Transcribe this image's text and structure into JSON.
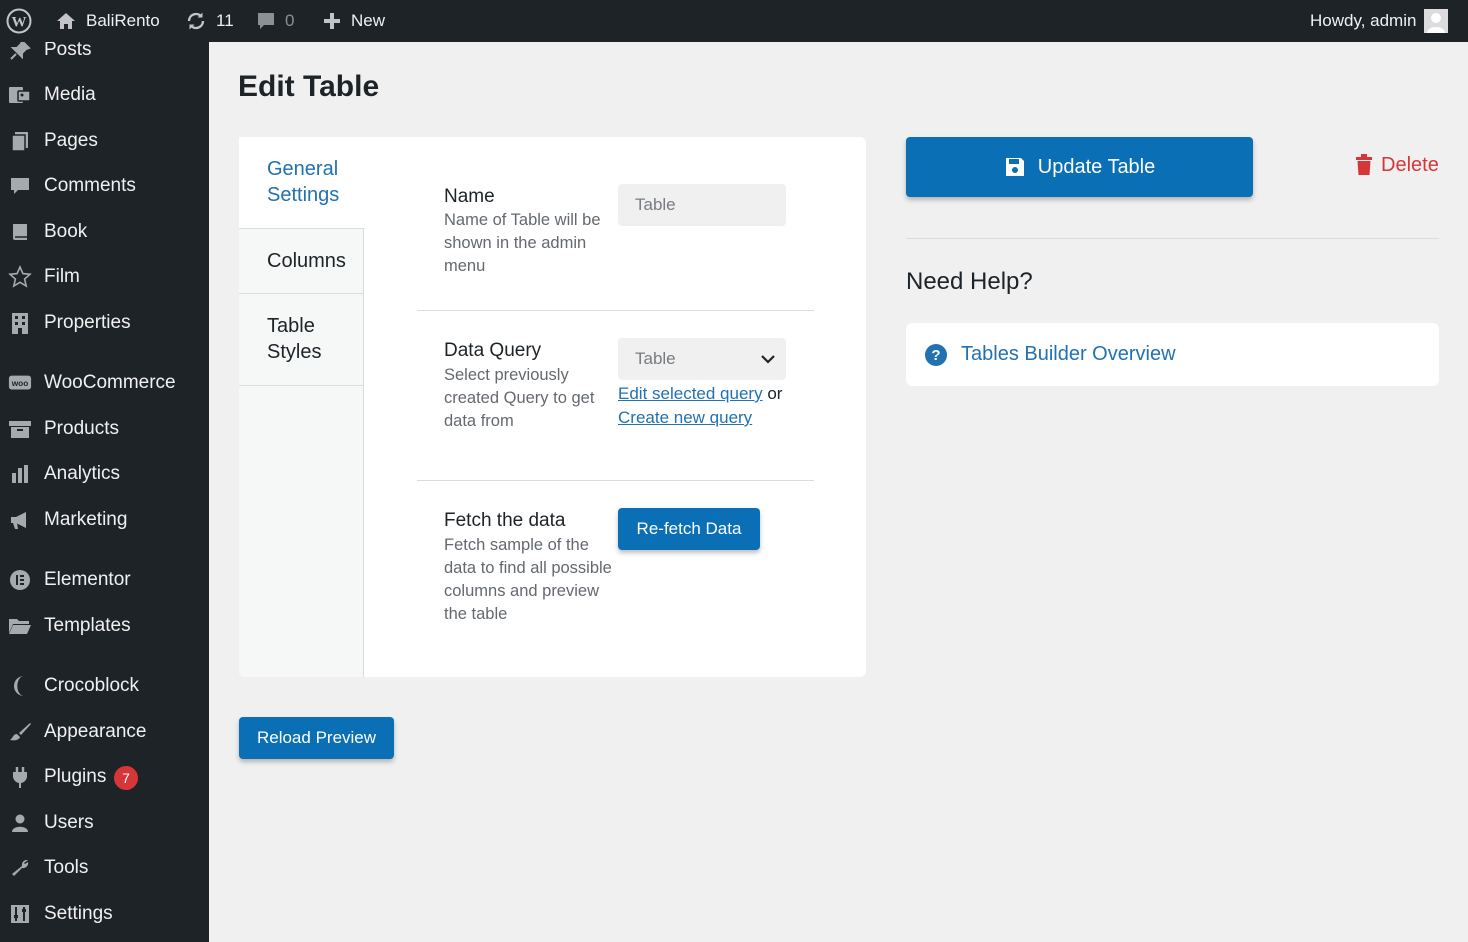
{
  "adminbar": {
    "site_name": "BaliRento",
    "updates_count": "11",
    "comments_count": "0",
    "new_label": "New",
    "greeting": "Howdy, admin"
  },
  "sidebar": {
    "items": [
      {
        "label": "Posts",
        "icon": "pin-icon"
      },
      {
        "label": "Media",
        "icon": "media-icon"
      },
      {
        "label": "Pages",
        "icon": "pages-icon"
      },
      {
        "label": "Comments",
        "icon": "comment-icon"
      },
      {
        "label": "Book",
        "icon": "book-icon"
      },
      {
        "label": "Film",
        "icon": "star-icon"
      },
      {
        "label": "Properties",
        "icon": "building-icon"
      },
      {
        "label": "WooCommerce",
        "icon": "woo-icon"
      },
      {
        "label": "Products",
        "icon": "archive-icon"
      },
      {
        "label": "Analytics",
        "icon": "bar-chart-icon"
      },
      {
        "label": "Marketing",
        "icon": "megaphone-icon"
      },
      {
        "label": "Elementor",
        "icon": "elementor-icon"
      },
      {
        "label": "Templates",
        "icon": "folder-icon"
      },
      {
        "label": "Crocoblock",
        "icon": "crocoblock-icon"
      },
      {
        "label": "Appearance",
        "icon": "brush-icon"
      },
      {
        "label": "Plugins",
        "icon": "plugin-icon",
        "badge": "7"
      },
      {
        "label": "Users",
        "icon": "user-icon"
      },
      {
        "label": "Tools",
        "icon": "wrench-icon"
      },
      {
        "label": "Settings",
        "icon": "sliders-icon"
      }
    ]
  },
  "main": {
    "title": "Edit Table",
    "tabs": [
      {
        "label": "General Settings"
      },
      {
        "label": "Columns"
      },
      {
        "label": "Table Styles"
      }
    ],
    "name": {
      "label": "Name",
      "description": "Name of Table will be shown in the admin menu",
      "value": "Table"
    },
    "query": {
      "label": "Data Query",
      "description": "Select previously created Query to get data from",
      "selected": "Table",
      "edit_link": "Edit selected query",
      "or_text": "or",
      "create_link": "Create new query"
    },
    "fetch": {
      "label": "Fetch the data",
      "description": "Fetch sample of the data to find all possible columns and preview the table",
      "button": "Re-fetch Data"
    },
    "reload_button": "Reload Preview"
  },
  "side": {
    "update_button": "Update Table",
    "delete_label": "Delete",
    "help_title": "Need Help?",
    "help_link": "Tables Builder Overview"
  },
  "colors": {
    "primary": "#0a6fb5",
    "link": "#2271b1",
    "danger": "#d63638",
    "sidebar_bg": "#1d2327"
  }
}
